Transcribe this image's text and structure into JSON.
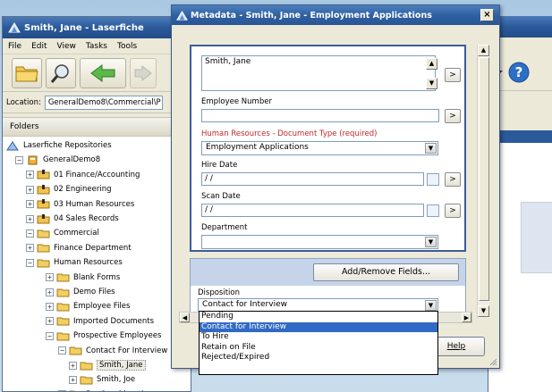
{
  "main_window": {
    "title": "Smith, Jane - Laserfiche",
    "menu": [
      "File",
      "Edit",
      "View",
      "Tasks",
      "Tools"
    ],
    "location_label": "Location:",
    "location_value": "GeneralDemo8\\Commercial\\P",
    "folders_label": "Folders",
    "tree": [
      {
        "label": "Laserfiche Repositories",
        "level": 0,
        "expander": "",
        "icon": "laserfiche-repositories-icon"
      },
      {
        "label": "GeneralDemo8",
        "level": 1,
        "expander": "−",
        "icon": "repository-icon"
      },
      {
        "label": "01 Finance/Accounting",
        "level": 2,
        "expander": "+",
        "icon": "cabinet-icon"
      },
      {
        "label": "02 Engineering",
        "level": 2,
        "expander": "+",
        "icon": "cabinet-icon"
      },
      {
        "label": "03 Human Resources",
        "level": 2,
        "expander": "+",
        "icon": "cabinet-icon"
      },
      {
        "label": "04 Sales Records",
        "level": 2,
        "expander": "+",
        "icon": "cabinet-icon"
      },
      {
        "label": "Commercial",
        "level": 2,
        "expander": "−",
        "icon": "folder-icon"
      },
      {
        "label": "Finance Department",
        "level": 3,
        "expander": "+",
        "icon": "folder-icon"
      },
      {
        "label": "Human Resources",
        "level": 3,
        "expander": "−",
        "icon": "folder-icon"
      },
      {
        "label": "Blank Forms",
        "level": 4,
        "expander": "+",
        "icon": "folder-icon"
      },
      {
        "label": "Demo Files",
        "level": 4,
        "expander": "+",
        "icon": "folder-icon"
      },
      {
        "label": "Employee Files",
        "level": 4,
        "expander": "+",
        "icon": "folder-icon"
      },
      {
        "label": "Imported Documents",
        "level": 4,
        "expander": "+",
        "icon": "folder-icon"
      },
      {
        "label": "Prospective Employees",
        "level": 4,
        "expander": "−",
        "icon": "folder-icon"
      },
      {
        "label": "Contact For Interview",
        "level": 5,
        "expander": "−",
        "icon": "folder-icon"
      },
      {
        "label": "Smith, Jane",
        "level": 6,
        "expander": "+",
        "icon": "folder-icon",
        "selected": true
      },
      {
        "label": "Smith, Joe",
        "level": 6,
        "expander": "+",
        "icon": "folder-icon"
      },
      {
        "label": "For Consideration",
        "level": 5,
        "expander": "+",
        "icon": "folder-icon"
      }
    ]
  },
  "dialog": {
    "title": "Metadata - Smith, Jane - Employment Applications",
    "close_label": "×",
    "name_value": "Smith, Jane",
    "employee_number_label": "Employee Number",
    "employee_number_value": "",
    "template_label": "Human Resources - Document Type (required)",
    "template_value": "Employment Applications",
    "hire_date_label": "Hire Date",
    "hire_date_value": " / /",
    "scan_date_label": "Scan Date",
    "scan_date_value": " / /",
    "department_label": "Department",
    "department_value": "",
    "add_remove_label": "Add/Remove Fields...",
    "disposition_label": "Disposition",
    "disposition_value": "Contact for Interview",
    "help_label": "Help",
    "arrow_btn_label": ">",
    "dropdown_options": [
      "Pending",
      "Contact for Interview",
      "To Hire",
      "Retain on File",
      "Rejected/Expired"
    ],
    "selected_option_index": 1
  },
  "colors": {
    "title_bar": "#2d5e9f",
    "required_label": "#c0272d",
    "selection": "#316ac5",
    "panel_border": "#3d5a9a"
  }
}
